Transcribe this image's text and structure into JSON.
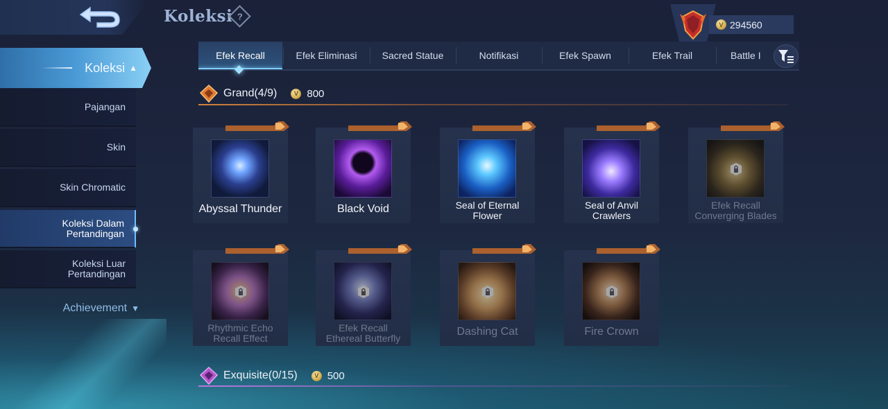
{
  "header": {
    "back_label": "back",
    "title": "Koleksi",
    "help_glyph": "?",
    "currency": {
      "value": "294560",
      "icon": "battle-point-coin-icon",
      "coin_glyph": "V"
    },
    "rank_icon": "rank-emblem-icon"
  },
  "sidebar": {
    "active_group": "Koleksi",
    "items": [
      {
        "label": "Pajangan",
        "selected": false
      },
      {
        "label": "Skin",
        "selected": false
      },
      {
        "label": "Skin Chromatic",
        "selected": false
      },
      {
        "label": "Koleksi Dalam\nPertandingan",
        "selected": true
      },
      {
        "label": "Koleksi Luar\nPertandingan",
        "selected": false
      }
    ],
    "achievement": "Achievement"
  },
  "tabs": [
    {
      "label": "Efek Recall",
      "active": true
    },
    {
      "label": "Efek Eliminasi",
      "active": false
    },
    {
      "label": "Sacred Statue",
      "active": false
    },
    {
      "label": "Notifikasi",
      "active": false
    },
    {
      "label": "Efek Spawn",
      "active": false
    },
    {
      "label": "Efek Trail",
      "active": false
    },
    {
      "label": "Battle I",
      "active": false
    }
  ],
  "sections": [
    {
      "title": "Grand(4/9)",
      "cost": "800",
      "accent": "#e48a3c",
      "items": [
        {
          "name": "Abyssal Thunder",
          "owned": true,
          "theme": "thunder"
        },
        {
          "name": "Black Void",
          "owned": true,
          "theme": "void"
        },
        {
          "name": "Seal of Eternal\nFlower",
          "owned": true,
          "theme": "flower"
        },
        {
          "name": "Seal of Anvil\nCrawlers",
          "owned": true,
          "theme": "anvil"
        },
        {
          "name": "Efek Recall\nConverging Blades",
          "owned": false,
          "theme": "blades"
        },
        {
          "name": "Rhythmic Echo\nRecall Effect",
          "owned": false,
          "theme": "echo"
        },
        {
          "name": "Efek Recall\nEthereal Butterfly",
          "owned": false,
          "theme": "butterfly"
        },
        {
          "name": "Dashing Cat",
          "owned": false,
          "theme": "cat"
        },
        {
          "name": "Fire Crown",
          "owned": false,
          "theme": "crown"
        }
      ]
    },
    {
      "title": "Exquisite(0/15)",
      "cost": "500",
      "accent": "#c97be0"
    }
  ]
}
